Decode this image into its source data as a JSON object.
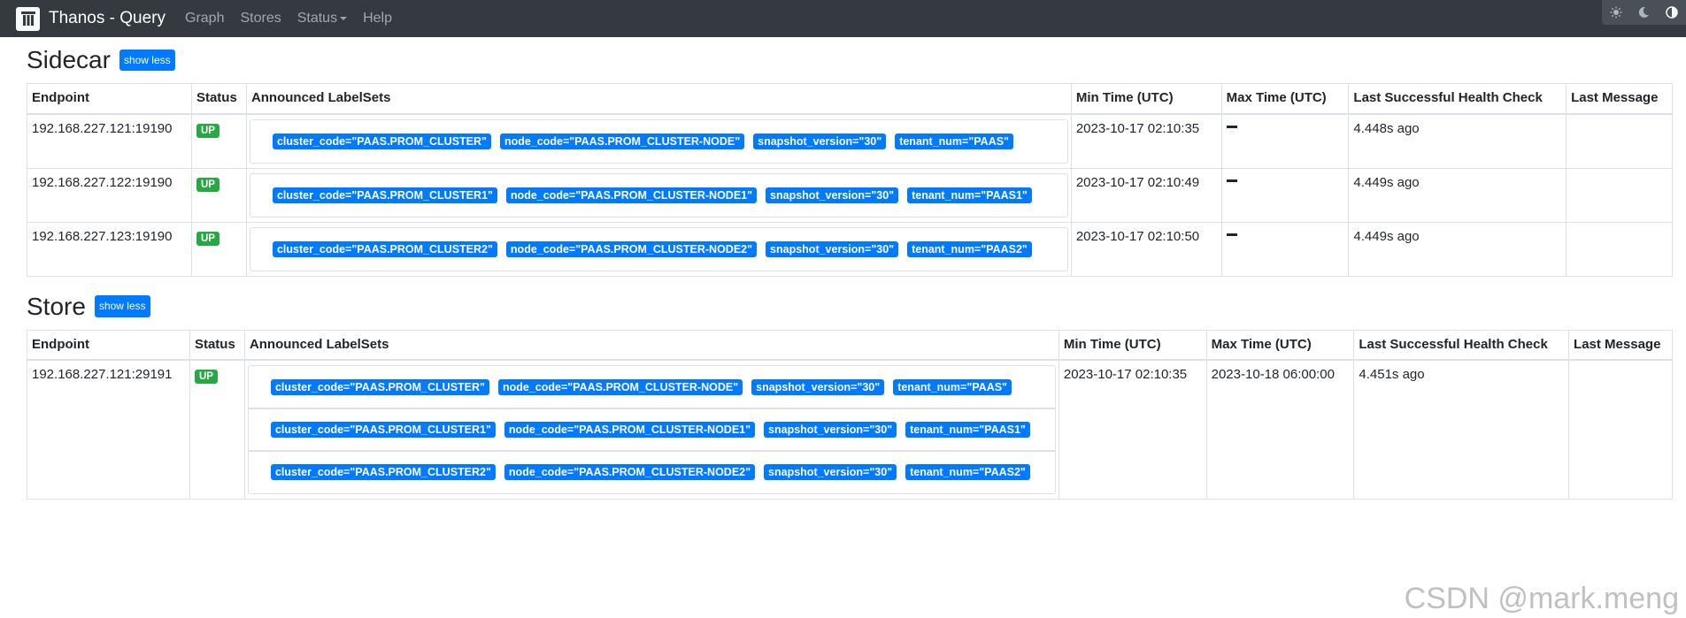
{
  "navbar": {
    "brand": "Thanos - Query",
    "links": [
      "Graph",
      "Stores",
      "Status",
      "Help"
    ],
    "logo_icon": "thanos-logo-icon",
    "theme_icons": [
      "sun-icon",
      "moon-icon",
      "contrast-icon"
    ]
  },
  "sidecar": {
    "title": "Sidecar",
    "toggle_label": "show less",
    "headers": [
      "Endpoint",
      "Status",
      "Announced LabelSets",
      "Min Time (UTC)",
      "Max Time (UTC)",
      "Last Successful Health Check",
      "Last Message"
    ],
    "rows": [
      {
        "endpoint": "192.168.227.121:19190",
        "status": "UP",
        "labelsets": [
          [
            "cluster_code=\"PAAS.PROM_CLUSTER\"",
            "node_code=\"PAAS.PROM_CLUSTER-NODE\"",
            "snapshot_version=\"30\"",
            "tenant_num=\"PAAS\""
          ]
        ],
        "min_time": "2023-10-17 02:10:35",
        "max_time": "—",
        "health": "4.448s ago",
        "message": ""
      },
      {
        "endpoint": "192.168.227.122:19190",
        "status": "UP",
        "labelsets": [
          [
            "cluster_code=\"PAAS.PROM_CLUSTER1\"",
            "node_code=\"PAAS.PROM_CLUSTER-NODE1\"",
            "snapshot_version=\"30\"",
            "tenant_num=\"PAAS1\""
          ]
        ],
        "min_time": "2023-10-17 02:10:49",
        "max_time": "—",
        "health": "4.449s ago",
        "message": ""
      },
      {
        "endpoint": "192.168.227.123:19190",
        "status": "UP",
        "labelsets": [
          [
            "cluster_code=\"PAAS.PROM_CLUSTER2\"",
            "node_code=\"PAAS.PROM_CLUSTER-NODE2\"",
            "snapshot_version=\"30\"",
            "tenant_num=\"PAAS2\""
          ]
        ],
        "min_time": "2023-10-17 02:10:50",
        "max_time": "—",
        "health": "4.449s ago",
        "message": ""
      }
    ]
  },
  "store": {
    "title": "Store",
    "toggle_label": "show less",
    "headers": [
      "Endpoint",
      "Status",
      "Announced LabelSets",
      "Min Time (UTC)",
      "Max Time (UTC)",
      "Last Successful Health Check",
      "Last Message"
    ],
    "rows": [
      {
        "endpoint": "192.168.227.121:29191",
        "status": "UP",
        "labelsets": [
          [
            "cluster_code=\"PAAS.PROM_CLUSTER\"",
            "node_code=\"PAAS.PROM_CLUSTER-NODE\"",
            "snapshot_version=\"30\"",
            "tenant_num=\"PAAS\""
          ],
          [
            "cluster_code=\"PAAS.PROM_CLUSTER1\"",
            "node_code=\"PAAS.PROM_CLUSTER-NODE1\"",
            "snapshot_version=\"30\"",
            "tenant_num=\"PAAS1\""
          ],
          [
            "cluster_code=\"PAAS.PROM_CLUSTER2\"",
            "node_code=\"PAAS.PROM_CLUSTER-NODE2\"",
            "snapshot_version=\"30\"",
            "tenant_num=\"PAAS2\""
          ]
        ],
        "min_time": "2023-10-17 02:10:35",
        "max_time": "2023-10-18 06:00:00",
        "health": "4.451s ago",
        "message": ""
      }
    ]
  },
  "watermark": "CSDN @mark.meng",
  "colors": {
    "navbar": "#343a40",
    "primary": "#007bff",
    "success": "#28a745"
  }
}
